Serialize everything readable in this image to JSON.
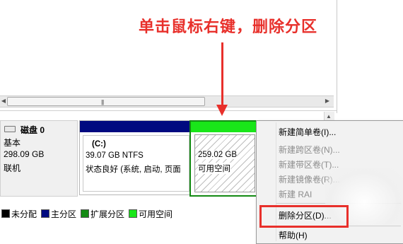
{
  "annotation": {
    "text": "单击鼠标右键，删除分区"
  },
  "disk": {
    "name": "磁盘 0",
    "type": "基本",
    "size": "298.09 GB",
    "status": "联机"
  },
  "partitions": [
    {
      "label": "(C:)",
      "size": "39.07 GB NTFS",
      "status": "状态良好 (系统, 启动, 页面"
    },
    {
      "size": "259.02 GB",
      "status": "可用空间"
    }
  ],
  "legend": [
    {
      "label": "未分配",
      "color": "#000000"
    },
    {
      "label": "主分区",
      "color": "#000a80"
    },
    {
      "label": "扩展分区",
      "color": "#138a13"
    },
    {
      "label": "可用空间",
      "color": "#19e619"
    }
  ],
  "context_menu": {
    "items": [
      {
        "label": "新建简单卷(I)...",
        "enabled": true
      },
      {
        "label": "新建跨区卷(N)...",
        "enabled": false
      },
      {
        "label": "新建带区卷(T)...",
        "enabled": false
      },
      {
        "label": "新建镜像卷(R)...",
        "enabled": false
      },
      {
        "label": "新建 RAI",
        "enabled": false
      },
      {
        "label": "删除分区(D)...",
        "enabled": true
      },
      {
        "label": "帮助(H)",
        "enabled": true
      }
    ]
  },
  "colors": {
    "annotation": "#e8302b",
    "primary_bar": "#000a80",
    "free_bar": "#19e619"
  }
}
